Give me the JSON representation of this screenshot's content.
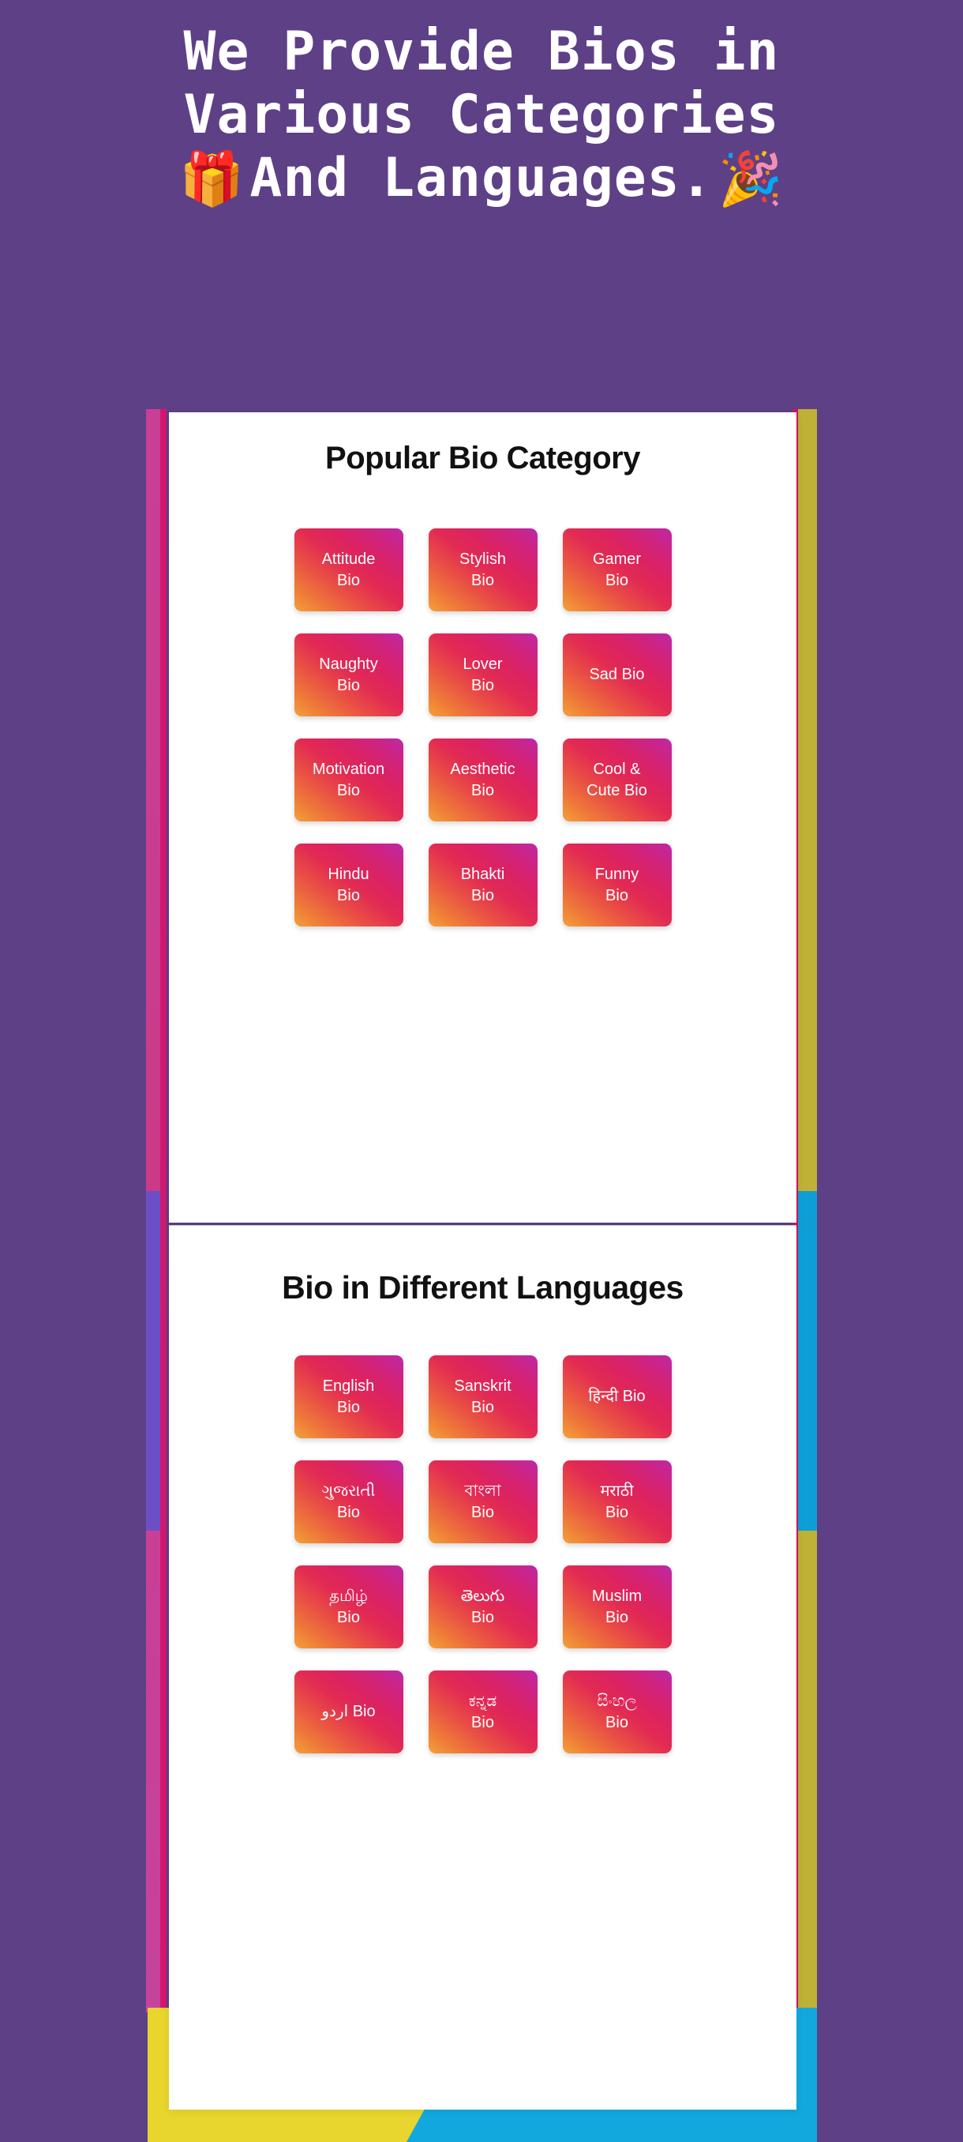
{
  "hero": {
    "line1": "We Provide Bios in",
    "line2": "Various Categories",
    "line3": "And Languages.",
    "emoji_left": "🎁",
    "emoji_right": "🎉",
    "emoji_left_name": "gift-emoji",
    "emoji_right_name": "party-popper-emoji",
    "background_color": "#5E4087",
    "text_color": "#FFFFFF"
  },
  "sections": [
    {
      "title": "Popular Bio Category",
      "tiles": [
        {
          "line1": "Attitude",
          "line2": "Bio"
        },
        {
          "line1": "Stylish",
          "line2": "Bio"
        },
        {
          "line1": "Gamer",
          "line2": "Bio"
        },
        {
          "line1": "Naughty",
          "line2": "Bio"
        },
        {
          "line1": "Lover",
          "line2": "Bio"
        },
        {
          "line1": "Sad Bio",
          "line2": ""
        },
        {
          "line1": "Motivation",
          "line2": "Bio"
        },
        {
          "line1": "Aesthetic",
          "line2": "Bio"
        },
        {
          "line1": "Cool &",
          "line2": "Cute Bio"
        },
        {
          "line1": "Hindu",
          "line2": "Bio"
        },
        {
          "line1": "Bhakti",
          "line2": "Bio"
        },
        {
          "line1": "Funny",
          "line2": "Bio"
        }
      ]
    },
    {
      "title": "Bio in Different Languages",
      "tiles": [
        {
          "line1": "English",
          "line2": "Bio"
        },
        {
          "line1": "Sanskrit",
          "line2": "Bio"
        },
        {
          "line1": "हिन्दी Bio",
          "line2": ""
        },
        {
          "line1": "ગુજરાતી",
          "line2": "Bio"
        },
        {
          "line1": "বাংলা",
          "line2": "Bio"
        },
        {
          "line1": "मराठी",
          "line2": "Bio"
        },
        {
          "line1": "தமிழ்",
          "line2": "Bio"
        },
        {
          "line1": "తెలుగు",
          "line2": "Bio"
        },
        {
          "line1": "Muslim",
          "line2": "Bio"
        },
        {
          "line1": "اردو Bio",
          "line2": ""
        },
        {
          "line1": "ಕನ್ನಡ",
          "line2": "Bio"
        },
        {
          "line1": "සිංහල",
          "line2": "Bio"
        }
      ]
    }
  ],
  "decor": {
    "strip_left_color": "#C83F95",
    "strip_left_accent": "#6C4FC4",
    "strip_left_edge": "#D5166E",
    "strip_right_color": "#BFB036",
    "strip_right_accent": "#0E9ED6",
    "strip_right_edge": "#C9175F",
    "tail_yellow": "#E8D62E",
    "tail_cyan": "#12A8DE",
    "panel_color": "#FFFFFF",
    "tile_gradient_start": "#F3A13A",
    "tile_gradient_mid": "#E22A53",
    "tile_gradient_end": "#BD29A8"
  }
}
